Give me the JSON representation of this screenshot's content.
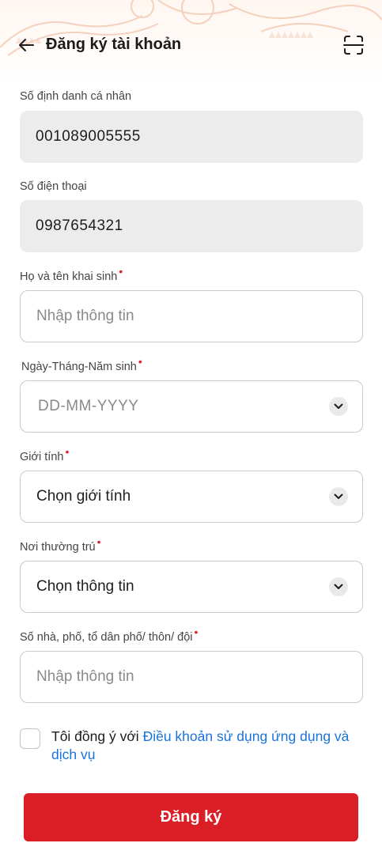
{
  "header": {
    "title": "Đăng ký tài khoản",
    "back_icon": "arrow-left-icon",
    "scan_icon": "scan-qr-icon"
  },
  "fields": {
    "id_number": {
      "label": "Số định danh cá nhân",
      "value": "001089005555"
    },
    "phone": {
      "label": "Số điện thoại",
      "value": "0987654321"
    },
    "full_name": {
      "label": "Họ và tên khai sinh",
      "placeholder": "Nhập thông tin"
    },
    "birth_date": {
      "label": "Ngày-Tháng-Năm sinh",
      "placeholder": "DD-MM-YYYY"
    },
    "gender": {
      "label": "Giới tính",
      "value": "Chọn giới tính"
    },
    "residence": {
      "label": "Nơi thường trú",
      "value": "Chọn thông tin"
    },
    "address": {
      "label": "Số nhà, phố, tổ dân phố/ thôn/ đội",
      "placeholder": "Nhập thông tin"
    }
  },
  "required_marker": "•",
  "agreement": {
    "prefix": "Tôi đồng ý với ",
    "link": "Điều khoản sử dụng ứng dụng và dịch vụ",
    "checked": false
  },
  "submit_label": "Đăng ký",
  "colors": {
    "primary": "#d91e25",
    "link": "#1a73d9",
    "required": "#e0242b",
    "filled_bg": "#ececec"
  }
}
